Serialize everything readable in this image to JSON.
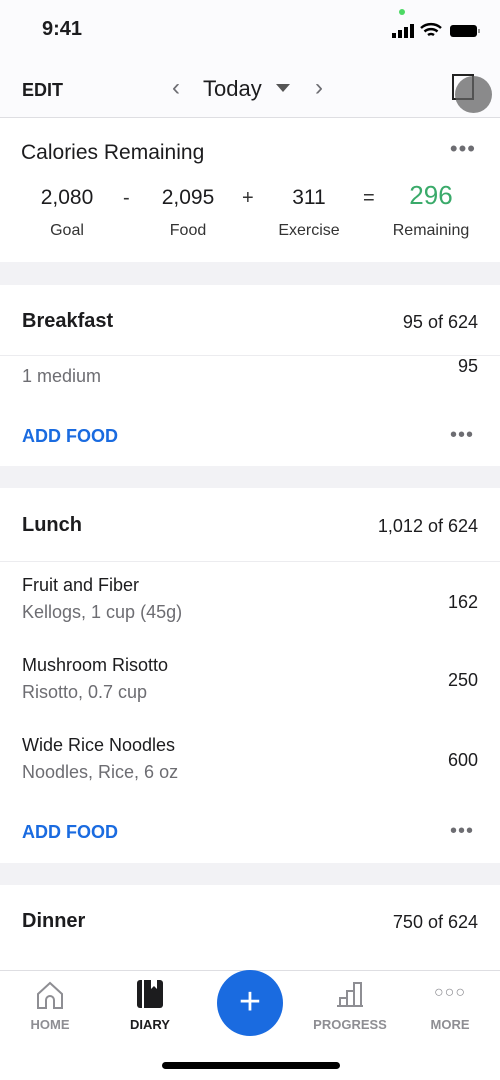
{
  "status": {
    "time": "9:41"
  },
  "header": {
    "edit": "EDIT",
    "date": "Today"
  },
  "calories": {
    "title": "Calories Remaining",
    "goal": "2,080",
    "goal_label": "Goal",
    "food": "2,095",
    "food_label": "Food",
    "exercise": "311",
    "exercise_label": "Exercise",
    "remaining": "296",
    "remaining_label": "Remaining",
    "minus": "-",
    "plus": "+",
    "equals": "=",
    "remaining_color": "#3aaa6a"
  },
  "meals": [
    {
      "title": "Breakfast",
      "calories": "95 of 624",
      "items": [
        {
          "desc": "1 medium",
          "cal": "95"
        }
      ],
      "add": "ADD FOOD"
    },
    {
      "title": "Lunch",
      "calories": "1,012 of 624",
      "items": [
        {
          "name": "Fruit and Fiber",
          "desc": "Kellogs, 1 cup (45g)",
          "cal": "162"
        },
        {
          "name": "Mushroom Risotto",
          "desc": "Risotto, 0.7 cup",
          "cal": "250"
        },
        {
          "name": "Wide Rice Noodles",
          "desc": "Noodles, Rice, 6 oz",
          "cal": "600"
        }
      ],
      "add": "ADD FOOD"
    },
    {
      "title": "Dinner",
      "calories": "750 of 624"
    }
  ],
  "tabs": [
    {
      "label": "HOME"
    },
    {
      "label": "DIARY",
      "active": true
    },
    {
      "label": "PROGRESS"
    },
    {
      "label": "MORE"
    }
  ],
  "fab": "+",
  "accent": "#1a6be0"
}
